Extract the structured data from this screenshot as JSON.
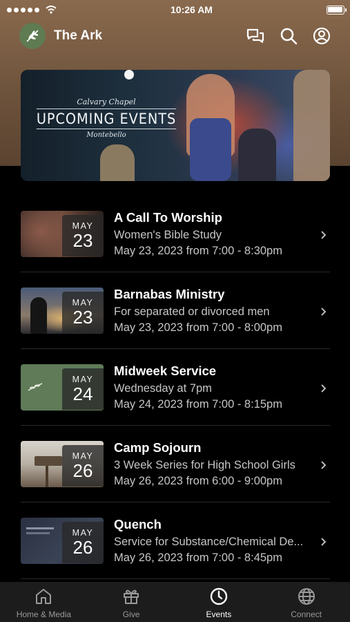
{
  "status_bar": {
    "time": "10:26 AM"
  },
  "header": {
    "title": "The Ark"
  },
  "hero": {
    "script_top": "Calvary Chapel",
    "main": "UPCOMING EVENTS",
    "script_bottom": "Montebello"
  },
  "events": [
    {
      "title": "A Call To Worship",
      "description": "Women's Bible Study",
      "time": "May 23, 2023 from 7:00 - 8:30pm",
      "month": "MAY",
      "day": "23"
    },
    {
      "title": "Barnabas Ministry",
      "description": "For separated or divorced men",
      "time": "May 23, 2023 from 7:00 - 8:00pm",
      "month": "MAY",
      "day": "23"
    },
    {
      "title": "Midweek Service",
      "description": "Wednesday at 7pm",
      "time": "May 24, 2023 from 7:00 - 8:15pm",
      "month": "MAY",
      "day": "24"
    },
    {
      "title": "Camp Sojourn",
      "description": "3 Week Series for High School Girls",
      "time": "May 26, 2023 from 6:00 - 9:00pm",
      "month": "MAY",
      "day": "26"
    },
    {
      "title": "Quench",
      "description": "Service for Substance/Chemical De...",
      "time": "May 26, 2023 from 7:00 - 8:45pm",
      "month": "MAY",
      "day": "26"
    }
  ],
  "tabs": [
    {
      "label": "Home & Media",
      "icon": "home-icon"
    },
    {
      "label": "Give",
      "icon": "gift-icon"
    },
    {
      "label": "Events",
      "icon": "clock-icon",
      "active": true
    },
    {
      "label": "Connect",
      "icon": "globe-icon"
    }
  ],
  "colors": {
    "header_bg": "#7a5c43",
    "tab_bar_bg": "#1c1c1c",
    "logo_bg": "#5f7b52"
  }
}
